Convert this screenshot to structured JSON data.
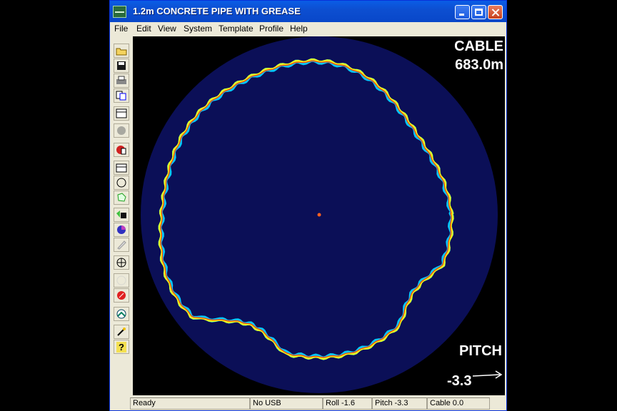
{
  "window": {
    "title": "1.2m CONCRETE PIPE WITH GREASE",
    "app_icon_label": "1512"
  },
  "menu": [
    "File",
    "Edit",
    "View",
    "System",
    "Template",
    "Profile",
    "Help"
  ],
  "toolbar": [
    "open-folder-icon",
    "save-icon",
    "print-icon",
    "copy-icon",
    "calendar-icon",
    "gray-circle-icon",
    "record-icon",
    "grid-icon",
    "circle-outline-icon",
    "green-shape-icon",
    "save-green-icon",
    "color-wheel-icon",
    "pencil-icon",
    "crosshair-icon",
    "blank-circle-icon",
    "stop-icon",
    "profile-icon",
    "wand-icon",
    "help-icon"
  ],
  "sonar": {
    "cable_label": "CABLE",
    "cable_value": "683.0m",
    "pitch_label": "PITCH",
    "pitch_value": "-3.3",
    "background_color": "#0b0f57",
    "ring_colors": [
      "#00c8ff",
      "#e8ff20",
      "#ff4a00"
    ]
  },
  "status": {
    "ready": "Ready",
    "usb": "No USB",
    "roll": "Roll -1.6",
    "pitch": "Pitch -3.3",
    "cable": "Cable 0.0"
  }
}
